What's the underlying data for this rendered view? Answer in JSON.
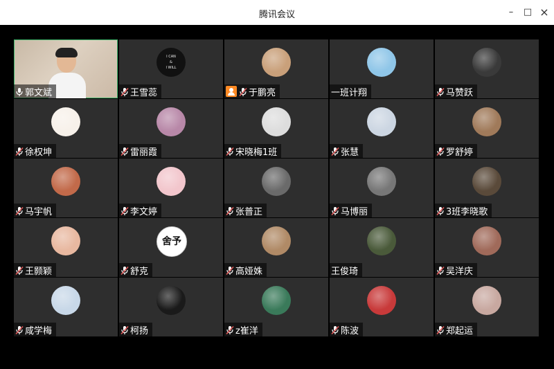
{
  "window": {
    "title": "腾讯会议",
    "controls": {
      "minimize": "–",
      "maximize": "□",
      "close": "×"
    }
  },
  "participants": [
    {
      "name": "郭文斌",
      "mic": "on",
      "video": true
    },
    {
      "name": "王雪蕊",
      "mic": "muted",
      "avatar_text": [
        "I CAN",
        "&",
        "I WILL"
      ],
      "avatar_color": "#111111"
    },
    {
      "name": "于鹏亮",
      "mic": "muted",
      "sharing_icon": "share-screen-icon",
      "avatar_color": "#c9a07a"
    },
    {
      "name": "一班计翔",
      "mic": "none",
      "avatar_color": "#8fc6e8"
    },
    {
      "name": "马赞跃",
      "mic": "muted",
      "avatar_color": "#3a3a3a"
    },
    {
      "name": "徐权坤",
      "mic": "muted",
      "avatar_color": "#f7f1ea"
    },
    {
      "name": "雷丽霞",
      "mic": "muted",
      "avatar_color": "#b888a8"
    },
    {
      "name": "宋晓梅1班",
      "mic": "muted",
      "avatar_color": "#dddddd"
    },
    {
      "name": "张慧",
      "mic": "muted",
      "avatar_color": "#ccd6e2"
    },
    {
      "name": "罗舒婷",
      "mic": "muted",
      "avatar_color": "#a07a5a"
    },
    {
      "name": "马宇帆",
      "mic": "muted",
      "avatar_color": "#c26a4a"
    },
    {
      "name": "李文婷",
      "mic": "muted",
      "avatar_color": "#f2c6cc"
    },
    {
      "name": "张普正",
      "mic": "muted",
      "avatar_color": "#6a6a6a"
    },
    {
      "name": "马博丽",
      "mic": "muted",
      "avatar_color": "#777777"
    },
    {
      "name": "3班李晓歌",
      "mic": "muted",
      "avatar_color": "#5a4a3a"
    },
    {
      "name": "王颢颖",
      "mic": "muted",
      "avatar_color": "#e8b8a0"
    },
    {
      "name": "舒克",
      "mic": "muted",
      "avatar_text": [
        "舍予"
      ],
      "avatar_color": "#ffffff"
    },
    {
      "name": "高娅姝",
      "mic": "muted",
      "avatar_color": "#b08a66"
    },
    {
      "name": "王俊琦",
      "mic": "none",
      "avatar_color": "#4a5a3a"
    },
    {
      "name": "吴洋庆",
      "mic": "muted",
      "avatar_color": "#a06a5a"
    },
    {
      "name": "咸学梅",
      "mic": "muted",
      "avatar_color": "#c8d8e8"
    },
    {
      "name": "柯扬",
      "mic": "muted",
      "avatar_color": "#1a1a1a"
    },
    {
      "name": "z崔洋",
      "mic": "muted",
      "avatar_color": "#3a7a5a"
    },
    {
      "name": "陈波",
      "mic": "muted",
      "avatar_color": "#c83a3a"
    },
    {
      "name": "郑起运",
      "mic": "muted",
      "avatar_color": "#c8a8a0"
    }
  ],
  "colors": {
    "tile_background": "#2e2e2e",
    "page_background": "#000000",
    "active_speaker_border": "#3fb56b",
    "muted_mic": "#e05a5a",
    "share_badge": "#ff8a24"
  }
}
